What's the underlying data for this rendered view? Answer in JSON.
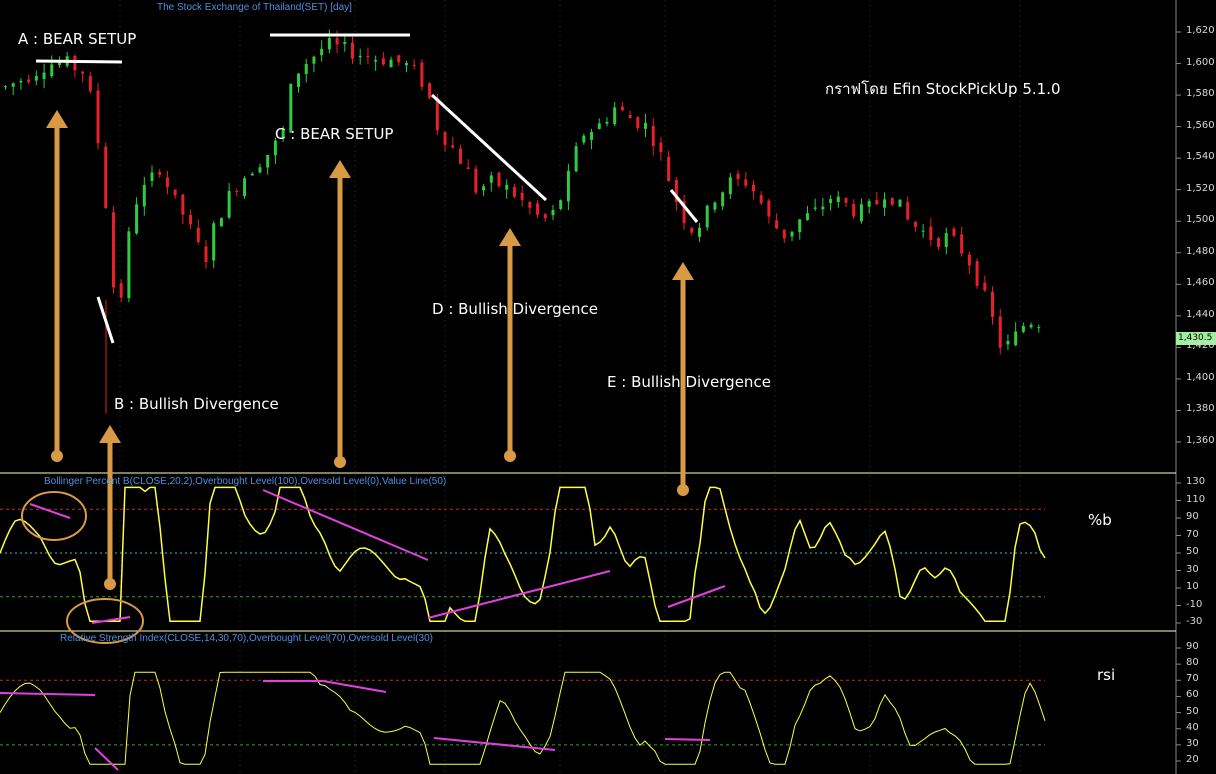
{
  "chart_title": "The Stock Exchange of Thailand(SET) [day]",
  "watermark": "กราฟโดย Efin StockPickUp 5.1.0",
  "last_price_label": "1,430.5",
  "annotations": {
    "a": "A : BEAR SETUP",
    "b": "B : Bullish Divergence",
    "c": "C : BEAR SETUP",
    "d": "D : Bullish Divergence",
    "e": "E : Bullish Divergence"
  },
  "price_axis_ticks": [
    "1,620",
    "1,600",
    "1,580",
    "1,560",
    "1,540",
    "1,520",
    "1,500",
    "1,480",
    "1,460",
    "1,440",
    "1,420",
    "1,400",
    "1,380",
    "1,360"
  ],
  "percent_b": {
    "title": "Bollinger Percent B(CLOSE,20,2),Overbought Level(100),Oversold Level(0),Value Line(50)",
    "label": "%b",
    "ticks": [
      "130",
      "110",
      "90",
      "70",
      "50",
      "30",
      "10",
      "-10",
      "-30"
    ]
  },
  "rsi": {
    "title": "Relative Strength Index(CLOSE,14,30,70),Overbought Level(70),Oversold Level(30)",
    "label": "rsi",
    "ticks": [
      "90",
      "80",
      "70",
      "60",
      "50",
      "40",
      "30",
      "20"
    ]
  },
  "colors": {
    "up": "#2ecc40",
    "down": "#e8202a",
    "arrow": "#d99a45",
    "indicator_line": "#ffff40",
    "rsi_line": "#ffff40",
    "divergence": "#e040e0",
    "trend": "#ffffff",
    "separator": "#ffffb0"
  },
  "chart_data": {
    "type": "candlestick",
    "close_anchors": [
      [
        0,
        1585
      ],
      [
        8,
        1592
      ],
      [
        15,
        1600
      ],
      [
        22,
        1600
      ],
      [
        28,
        1595
      ],
      [
        32,
        1570
      ],
      [
        36,
        1515
      ],
      [
        40,
        1440
      ],
      [
        42,
        1455
      ],
      [
        46,
        1510
      ],
      [
        52,
        1525
      ],
      [
        56,
        1535
      ],
      [
        60,
        1515
      ],
      [
        64,
        1505
      ],
      [
        68,
        1490
      ],
      [
        72,
        1475
      ],
      [
        76,
        1500
      ],
      [
        82,
        1520
      ],
      [
        88,
        1532
      ],
      [
        96,
        1545
      ],
      [
        100,
        1555
      ],
      [
        104,
        1592
      ],
      [
        108,
        1600
      ],
      [
        116,
        1612
      ],
      [
        124,
        1608
      ],
      [
        132,
        1604
      ],
      [
        140,
        1602
      ],
      [
        146,
        1598
      ],
      [
        152,
        1585
      ],
      [
        156,
        1560
      ],
      [
        160,
        1550
      ],
      [
        166,
        1535
      ],
      [
        170,
        1520
      ],
      [
        176,
        1525
      ],
      [
        182,
        1520
      ],
      [
        188,
        1510
      ],
      [
        194,
        1500
      ],
      [
        198,
        1505
      ],
      [
        202,
        1520
      ],
      [
        208,
        1555
      ],
      [
        214,
        1560
      ],
      [
        220,
        1572
      ],
      [
        226,
        1565
      ],
      [
        232,
        1560
      ],
      [
        236,
        1545
      ],
      [
        240,
        1525
      ],
      [
        244,
        1505
      ],
      [
        248,
        1495
      ],
      [
        252,
        1500
      ],
      [
        256,
        1515
      ],
      [
        262,
        1525
      ],
      [
        268,
        1525
      ],
      [
        272,
        1515
      ],
      [
        276,
        1500
      ],
      [
        282,
        1490
      ],
      [
        286,
        1500
      ],
      [
        292,
        1505
      ],
      [
        298,
        1515
      ],
      [
        304,
        1510
      ],
      [
        308,
        1505
      ],
      [
        314,
        1510
      ],
      [
        318,
        1520
      ],
      [
        322,
        1512
      ],
      [
        326,
        1500
      ],
      [
        330,
        1495
      ],
      [
        336,
        1488
      ],
      [
        340,
        1490
      ],
      [
        344,
        1485
      ],
      [
        348,
        1475
      ],
      [
        352,
        1460
      ],
      [
        356,
        1440
      ],
      [
        360,
        1418
      ],
      [
        364,
        1425
      ],
      [
        368,
        1435
      ],
      [
        372,
        1438
      ],
      [
        376,
        1432
      ]
    ],
    "percent_b_range": [
      -30,
      130
    ],
    "rsi_range": [
      20,
      90
    ],
    "price_range": [
      1340,
      1630
    ]
  }
}
